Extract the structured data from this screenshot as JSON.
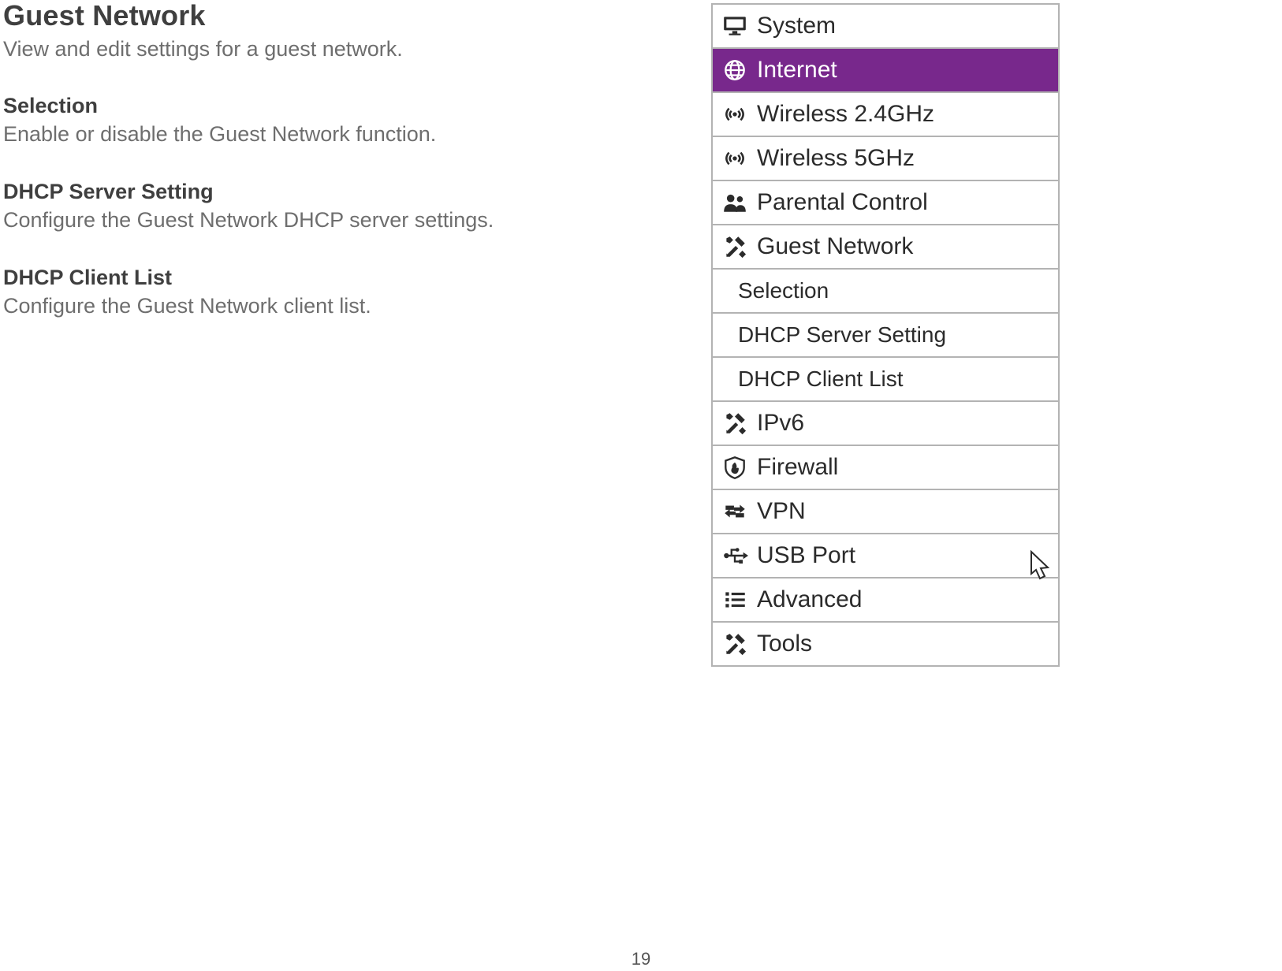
{
  "main": {
    "title": "Guest Network",
    "lead": "View and edit settings for a guest network.",
    "sections": [
      {
        "heading": "Selection",
        "body": "Enable or disable the Guest Network function."
      },
      {
        "heading": "DHCP Server Setting",
        "body": "Configure the Guest Network DHCP server settings."
      },
      {
        "heading": "DHCP Client List",
        "body": "Configure the Guest Network client list."
      }
    ]
  },
  "nav": {
    "items": [
      {
        "id": "system",
        "label": "System",
        "icon": "monitor-icon"
      },
      {
        "id": "internet",
        "label": "Internet",
        "icon": "globe-icon",
        "selected": true
      },
      {
        "id": "wireless-24",
        "label": "Wireless 2.4GHz",
        "icon": "wifi-icon"
      },
      {
        "id": "wireless-5",
        "label": "Wireless 5GHz",
        "icon": "wifi-icon"
      },
      {
        "id": "parental",
        "label": "Parental Control",
        "icon": "users-icon"
      },
      {
        "id": "guest-network",
        "label": "Guest Network",
        "icon": "tools-icon"
      },
      {
        "id": "ipv6",
        "label": "IPv6",
        "icon": "tools-icon"
      },
      {
        "id": "firewall",
        "label": "Firewall",
        "icon": "firewall-icon"
      },
      {
        "id": "vpn",
        "label": "VPN",
        "icon": "vpn-icon"
      },
      {
        "id": "usb",
        "label": "USB Port",
        "icon": "usb-icon"
      },
      {
        "id": "advanced",
        "label": "Advanced",
        "icon": "list-icon"
      },
      {
        "id": "tools",
        "label": "Tools",
        "icon": "tools-icon"
      }
    ],
    "subItems": [
      {
        "label": "Selection"
      },
      {
        "label": "DHCP Server Setting"
      },
      {
        "label": "DHCP Client List"
      }
    ]
  },
  "pageNumber": "19",
  "colors": {
    "accent": "#78288c"
  }
}
